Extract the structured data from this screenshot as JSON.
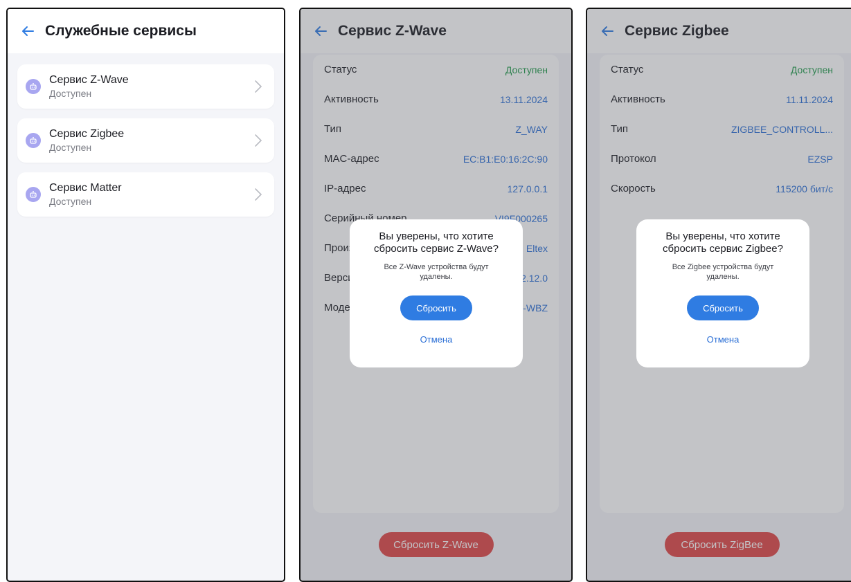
{
  "screen1": {
    "title": "Служебные сервисы",
    "items": [
      {
        "title": "Сервис Z-Wave",
        "status": "Доступен"
      },
      {
        "title": "Сервис Zigbee",
        "status": "Доступен"
      },
      {
        "title": "Сервис Matter",
        "status": "Доступен"
      }
    ]
  },
  "screen2": {
    "title": "Сервис Z-Wave",
    "rows": [
      {
        "label": "Статус",
        "value": "Доступен"
      },
      {
        "label": "Активность",
        "value": "13.11.2024"
      },
      {
        "label": "Тип",
        "value": "Z_WAY"
      },
      {
        "label": "MAC-адрес",
        "value": "EC:B1:E0:16:2C:90"
      },
      {
        "label": "IP-адрес",
        "value": "127.0.0.1"
      },
      {
        "label": "Серийный номер",
        "value": "VI9F000265"
      },
      {
        "label": "Производитель",
        "value": "Eltex"
      },
      {
        "label": "Версия",
        "value": "2.12.0"
      },
      {
        "label": "Модель",
        "value": "-WBZ"
      }
    ],
    "reset_label": "Сбросить Z-Wave",
    "dialog": {
      "title": "Вы уверены, что хотите сбросить сервис Z-Wave?",
      "text": "Все Z-Wave устройства будут удалены.",
      "confirm": "Сбросить",
      "cancel": "Отмена"
    }
  },
  "screen3": {
    "title": "Сервис Zigbee",
    "rows": [
      {
        "label": "Статус",
        "value": "Доступен"
      },
      {
        "label": "Активность",
        "value": "11.11.2024"
      },
      {
        "label": "Тип",
        "value": "ZIGBEE_CONTROLL..."
      },
      {
        "label": "Протокол",
        "value": "EZSP"
      },
      {
        "label": "Скорость",
        "value": "115200 бит/с"
      }
    ],
    "reset_label": "Сбросить ZigBee",
    "dialog": {
      "title": "Вы уверены, что хотите сбросить сервис Zigbee?",
      "text": "Все Zigbee устройства будут удалены.",
      "confirm": "Сбросить",
      "cancel": "Отмена"
    }
  },
  "colors": {
    "accent": "#2f7ce2",
    "ok": "#1f9a4a",
    "danger": "#e04646",
    "icon_bg": "#a8a6f0"
  },
  "icons": {
    "back": "arrow-left-icon",
    "service": "service-robot-icon",
    "chevron": "chevron-right-icon"
  }
}
